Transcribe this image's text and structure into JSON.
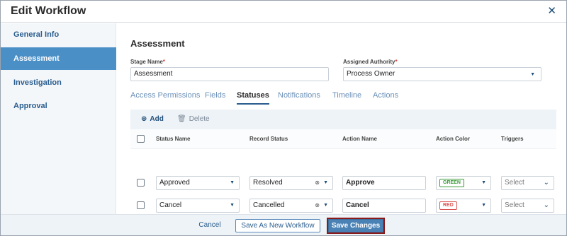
{
  "dialog": {
    "title": "Edit Workflow",
    "close_glyph": "✕"
  },
  "sidebar": {
    "items": [
      {
        "label": "General Info"
      },
      {
        "label": "Assessment"
      },
      {
        "label": "Investigation"
      },
      {
        "label": "Approval"
      }
    ],
    "active": "Assessment"
  },
  "stage": {
    "section_title": "Assessment",
    "name_label": "Stage Name",
    "name_value": "Assessment",
    "authority_label": "Assigned Authority",
    "authority_value": "Process Owner",
    "required_mark": "*"
  },
  "tabs": {
    "items": [
      {
        "label": "Access Permissions"
      },
      {
        "label": "Fields"
      },
      {
        "label": "Statuses"
      },
      {
        "label": "Notifications"
      },
      {
        "label": "Timeline"
      },
      {
        "label": "Actions"
      }
    ],
    "active": "Statuses"
  },
  "toolbar": {
    "add_label": "Add",
    "delete_label": "Delete",
    "add_icon": "plus-circle-icon",
    "delete_icon": "trash-icon"
  },
  "table": {
    "columns": [
      "Status Name",
      "Record Status",
      "Action Name",
      "Action Color",
      "Triggers"
    ],
    "rows": [
      {
        "status_name": "Approved",
        "record_status": "Resolved",
        "action_name": "Approve",
        "action_color": "GREEN",
        "triggers": "Select"
      },
      {
        "status_name": "Cancel",
        "record_status": "Cancelled",
        "action_name": "Cancel",
        "action_color": "RED",
        "triggers": "Select"
      }
    ]
  },
  "colors": {
    "accent": "#4b8fc7",
    "green": "#3a9a3a",
    "red": "#d9534f"
  },
  "footer": {
    "cancel_label": "Cancel",
    "save_new_label": "Save As New Workflow",
    "save_label": "Save Changes"
  }
}
